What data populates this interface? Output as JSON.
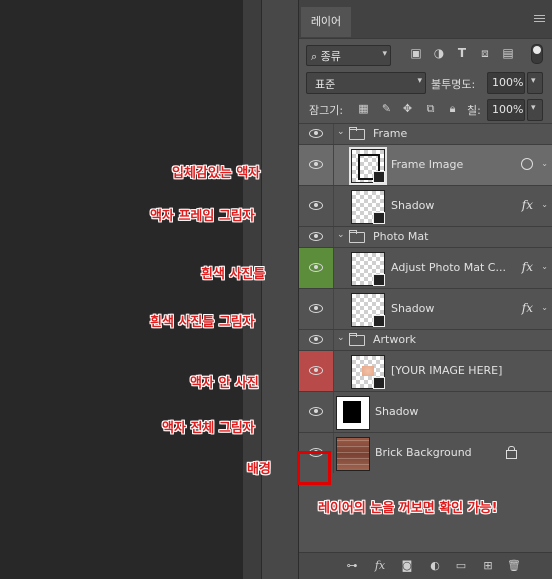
{
  "panel": {
    "tab_label": "레이어",
    "filter_label": "종류",
    "blend_mode": "표준",
    "opacity_label": "불투명도:",
    "opacity_value": "100%",
    "lock_label": "잠그기:",
    "fill_label": "칠:",
    "fill_value": "100%"
  },
  "filter_icons": [
    "image-filter-icon",
    "adjustment-filter-icon",
    "type-filter-icon",
    "shape-filter-icon",
    "smart-object-filter-icon",
    "filter-toggle-icon"
  ],
  "lock_icons": [
    "lock-transparent-icon",
    "lock-image-icon",
    "lock-position-icon",
    "lock-artboard-icon",
    "lock-all-icon"
  ],
  "layers": [
    {
      "type": "group",
      "name": "Frame"
    },
    {
      "type": "layer",
      "name": "Frame Image",
      "selected": true,
      "badge": "smart-object-icon"
    },
    {
      "type": "layer",
      "name": "Shadow",
      "fx": "fx"
    },
    {
      "type": "group",
      "name": "Photo Mat"
    },
    {
      "type": "layer",
      "name": "Adjust Photo Mat C...",
      "fx": "fx",
      "eye_color": "#5b8d3a"
    },
    {
      "type": "layer",
      "name": "Shadow",
      "fx": "fx"
    },
    {
      "type": "group",
      "name": "Artwork"
    },
    {
      "type": "layer",
      "name": "[YOUR IMAGE HERE]",
      "eye_color": "#b84a4a"
    },
    {
      "type": "layer",
      "name": "Shadow"
    },
    {
      "type": "layer",
      "name": "Brick Background",
      "locked": true
    }
  ],
  "annotations": [
    "입체감있는 액자",
    "액자 프레임 그림자",
    "흰색 사진틀",
    "흰색 사진틀 그림자",
    "액자 안 사진",
    "액자 전체 그림자",
    "배경",
    "레이어의 눈을 꺼보면 확인 가능!"
  ],
  "annotation_color": "#e01b1b",
  "bottom_icons": [
    "link-icon",
    "fx-icon",
    "mask-icon",
    "adjustment-icon",
    "new-group-icon",
    "new-layer-icon",
    "trash-icon"
  ],
  "bottom_fx_label": "fx"
}
